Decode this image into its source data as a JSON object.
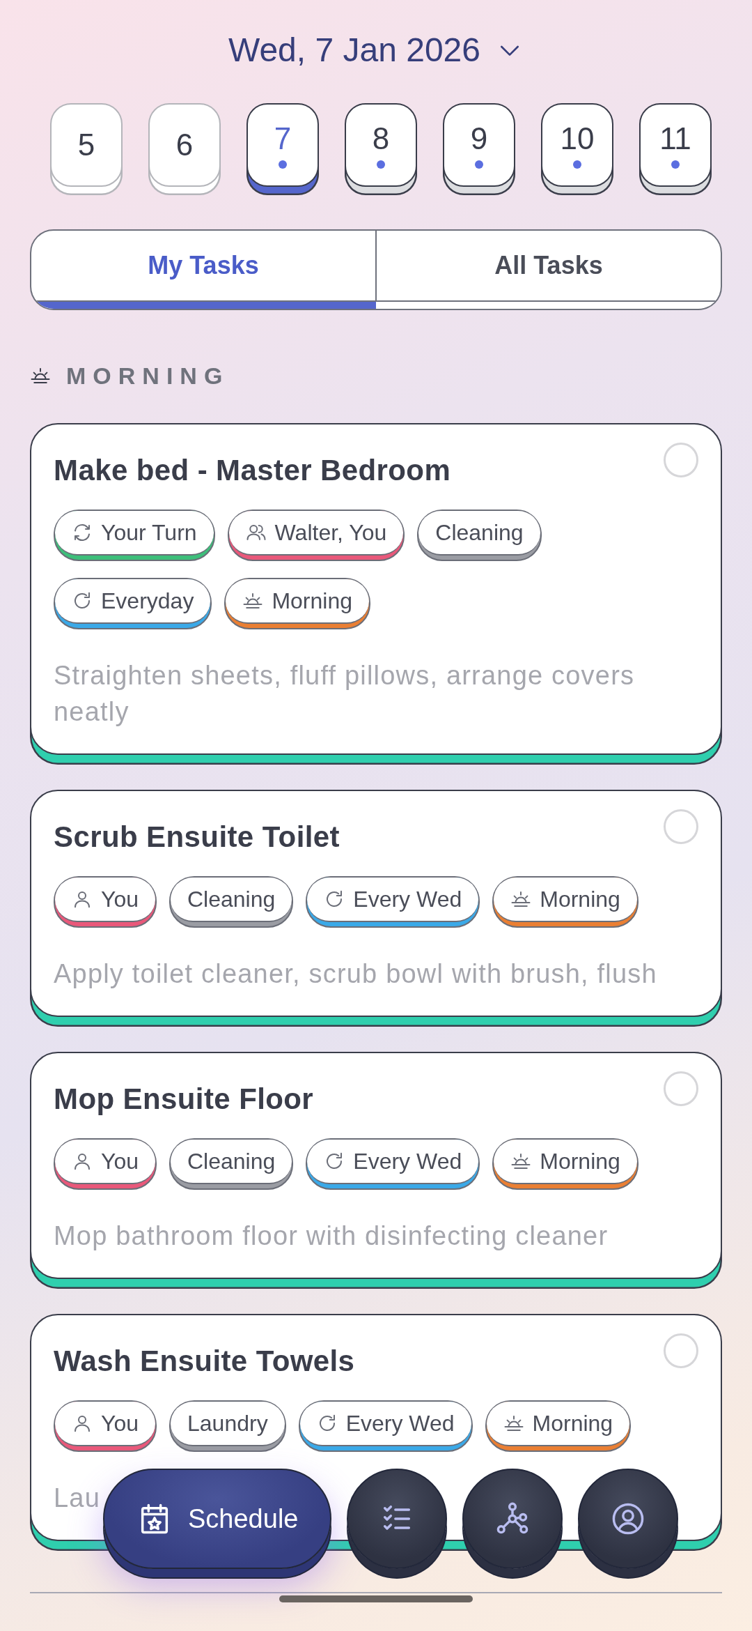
{
  "header": {
    "date": "Wed, 7 Jan 2026"
  },
  "days": [
    {
      "label": "5",
      "selected": false,
      "past": true,
      "dot": false
    },
    {
      "label": "6",
      "selected": false,
      "past": true,
      "dot": false
    },
    {
      "label": "7",
      "selected": true,
      "past": false,
      "dot": true
    },
    {
      "label": "8",
      "selected": false,
      "past": false,
      "dot": true
    },
    {
      "label": "9",
      "selected": false,
      "past": false,
      "dot": true
    },
    {
      "label": "10",
      "selected": false,
      "past": false,
      "dot": true
    },
    {
      "label": "11",
      "selected": false,
      "past": false,
      "dot": true
    }
  ],
  "tabs": [
    {
      "label": "My Tasks",
      "selected": true
    },
    {
      "label": "All Tasks",
      "selected": false
    }
  ],
  "section": {
    "title": "MORNING"
  },
  "tasks": [
    {
      "title": "Make bed - Master Bedroom",
      "done": false,
      "description": "Straighten sheets, fluff pillows, arrange covers neatly",
      "tags": [
        {
          "kind": "turn",
          "label": "Your Turn",
          "color": "#3dbf7a"
        },
        {
          "kind": "people",
          "label": "Walter, You",
          "color": "#e9587a"
        },
        {
          "kind": "category",
          "label": "Cleaning",
          "color": "#9a9ca3"
        },
        {
          "kind": "repeat",
          "label": "Everyday",
          "color": "#3aa9e8"
        },
        {
          "kind": "time",
          "label": "Morning",
          "color": "#ea7f33"
        }
      ]
    },
    {
      "title": "Scrub Ensuite Toilet",
      "done": false,
      "description": "Apply toilet cleaner, scrub bowl with brush, flush",
      "tags": [
        {
          "kind": "person",
          "label": "You",
          "color": "#e9587a"
        },
        {
          "kind": "category",
          "label": "Cleaning",
          "color": "#9a9ca3"
        },
        {
          "kind": "repeat",
          "label": "Every Wed",
          "color": "#3aa9e8"
        },
        {
          "kind": "time",
          "label": "Morning",
          "color": "#ea7f33"
        }
      ]
    },
    {
      "title": "Mop Ensuite Floor",
      "done": false,
      "description": "Mop bathroom floor with disinfecting cleaner",
      "tags": [
        {
          "kind": "person",
          "label": "You",
          "color": "#e9587a"
        },
        {
          "kind": "category",
          "label": "Cleaning",
          "color": "#9a9ca3"
        },
        {
          "kind": "repeat",
          "label": "Every Wed",
          "color": "#3aa9e8"
        },
        {
          "kind": "time",
          "label": "Morning",
          "color": "#ea7f33"
        }
      ]
    },
    {
      "title": "Wash Ensuite Towels",
      "done": false,
      "description": "Lau",
      "tags": [
        {
          "kind": "person",
          "label": "You",
          "color": "#e9587a"
        },
        {
          "kind": "category",
          "label": "Laundry",
          "color": "#9a9ca3"
        },
        {
          "kind": "repeat",
          "label": "Every Wed",
          "color": "#3aa9e8"
        },
        {
          "kind": "time",
          "label": "Morning",
          "color": "#ea7f33"
        }
      ]
    }
  ],
  "nav": [
    {
      "kind": "schedule",
      "label": "Schedule",
      "selected": true
    },
    {
      "kind": "tasks",
      "selected": false
    },
    {
      "kind": "graph",
      "selected": false
    },
    {
      "kind": "profile",
      "selected": false
    }
  ]
}
